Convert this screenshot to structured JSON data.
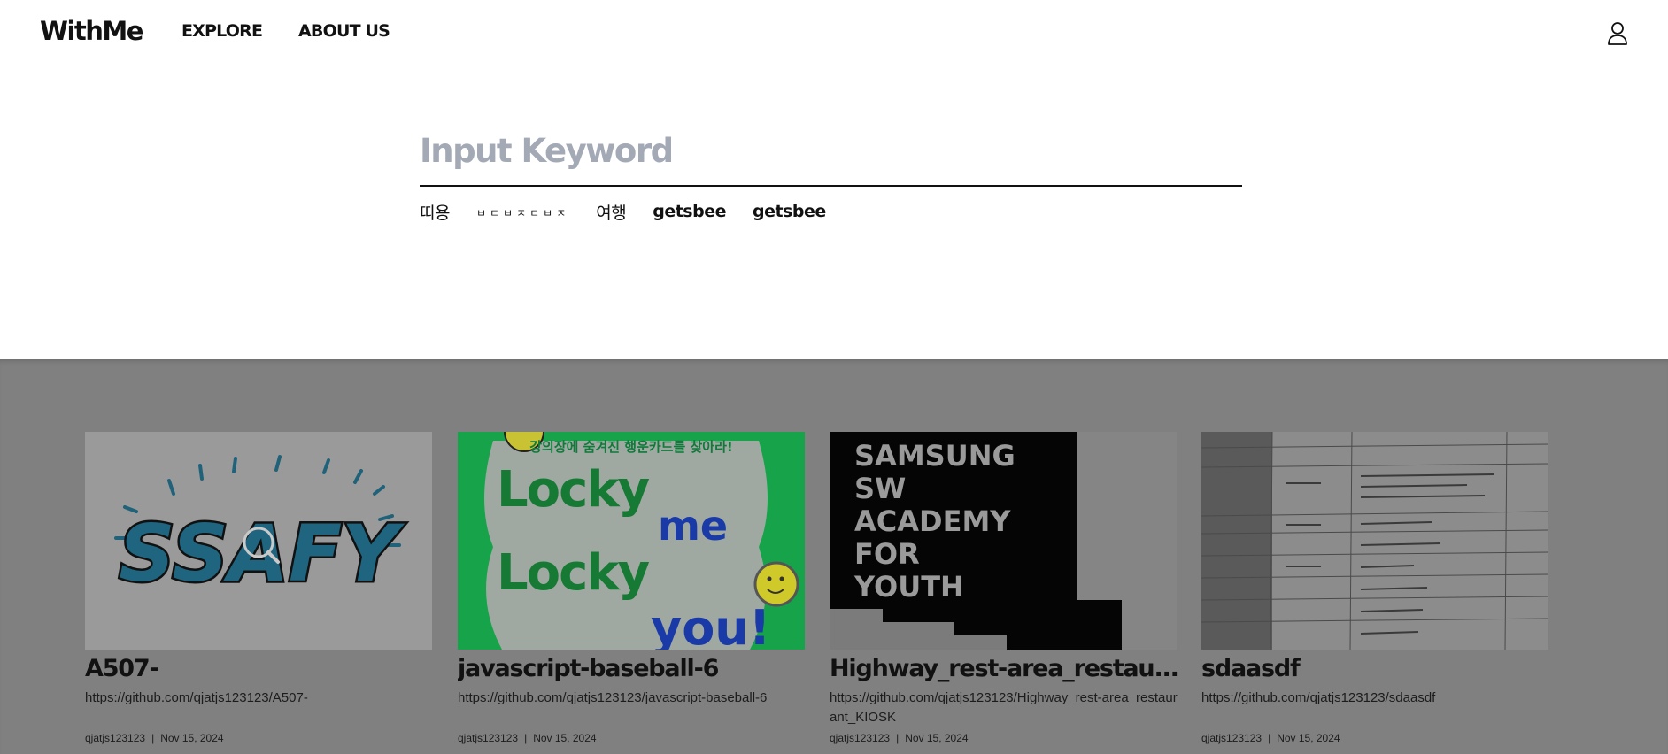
{
  "header": {
    "logo": "WithMe",
    "nav": [
      {
        "label": "EXPLORE"
      },
      {
        "label": "ABOUT US"
      }
    ],
    "user_icon": "user-icon"
  },
  "search": {
    "placeholder": "Input Keyword",
    "value": ""
  },
  "keywords": [
    "띠용",
    "ㅂㄷㅂㅈㄷㅂㅈ",
    "여행",
    "getsbee",
    "getsbee"
  ],
  "cards": [
    {
      "title": "A507-",
      "link": "https://github.com/qjatjs123123/A507-",
      "author": "qjatjs123123",
      "separator": "|",
      "date": "Nov 15, 2024",
      "thumb_text": "SSAFY"
    },
    {
      "title": "javascript-baseball-6",
      "link": "https://github.com/qjatjs123123/javascript-baseball-6",
      "author": "qjatjs123123",
      "separator": "|",
      "date": "Nov 15, 2024",
      "thumb_top": "강의장에 숨겨진 행운카드를 찾아라!",
      "thumb_line1": "Locky",
      "thumb_line2": "me",
      "thumb_line3": "Locky",
      "thumb_line4": "you!"
    },
    {
      "title": "Highway_rest-area_restau...",
      "link": "https://github.com/qjatjs123123/Highway_rest-area_restaurant_KIOSK",
      "author": "qjatjs123123",
      "separator": "|",
      "date": "Nov 15, 2024",
      "thumb_lines": [
        "SAMSUNG",
        "SW",
        "ACADEMY",
        "FOR",
        "YOUTH"
      ]
    },
    {
      "title": "sdaasdf",
      "link": "https://github.com/qjatjs123123/sdaasdf",
      "author": "qjatjs123123",
      "separator": "|",
      "date": "Nov 15, 2024"
    }
  ],
  "colors": {
    "overlay": "#808080",
    "placeholder": "#a3a9b5",
    "green": "#1fae4f",
    "blue": "#1b46c9"
  }
}
